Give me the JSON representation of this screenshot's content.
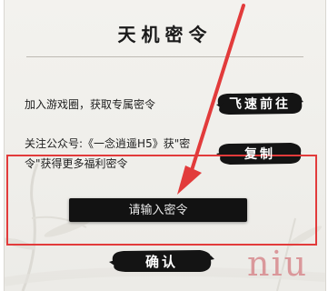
{
  "dialog": {
    "title": "天机密令",
    "row1_text": "加入游戏圈，获取专属密令",
    "row2_text": "关注公众号:《一念逍遥H5》获\"密令\"获得更多福利密令",
    "go_button_label": "飞速前往",
    "copy_button_label": "复制",
    "input_placeholder": "请输入密令",
    "input_value": "",
    "confirm_button_label": "确认"
  },
  "watermark": {
    "text": "niu"
  },
  "colors": {
    "panel_bg": "#efeeea",
    "ink_black": "#121212",
    "annotation_red": "#e23b3b",
    "watermark_pink": "#d98f93"
  },
  "icons": {
    "annotation_arrow": "red-arrow-icon"
  }
}
